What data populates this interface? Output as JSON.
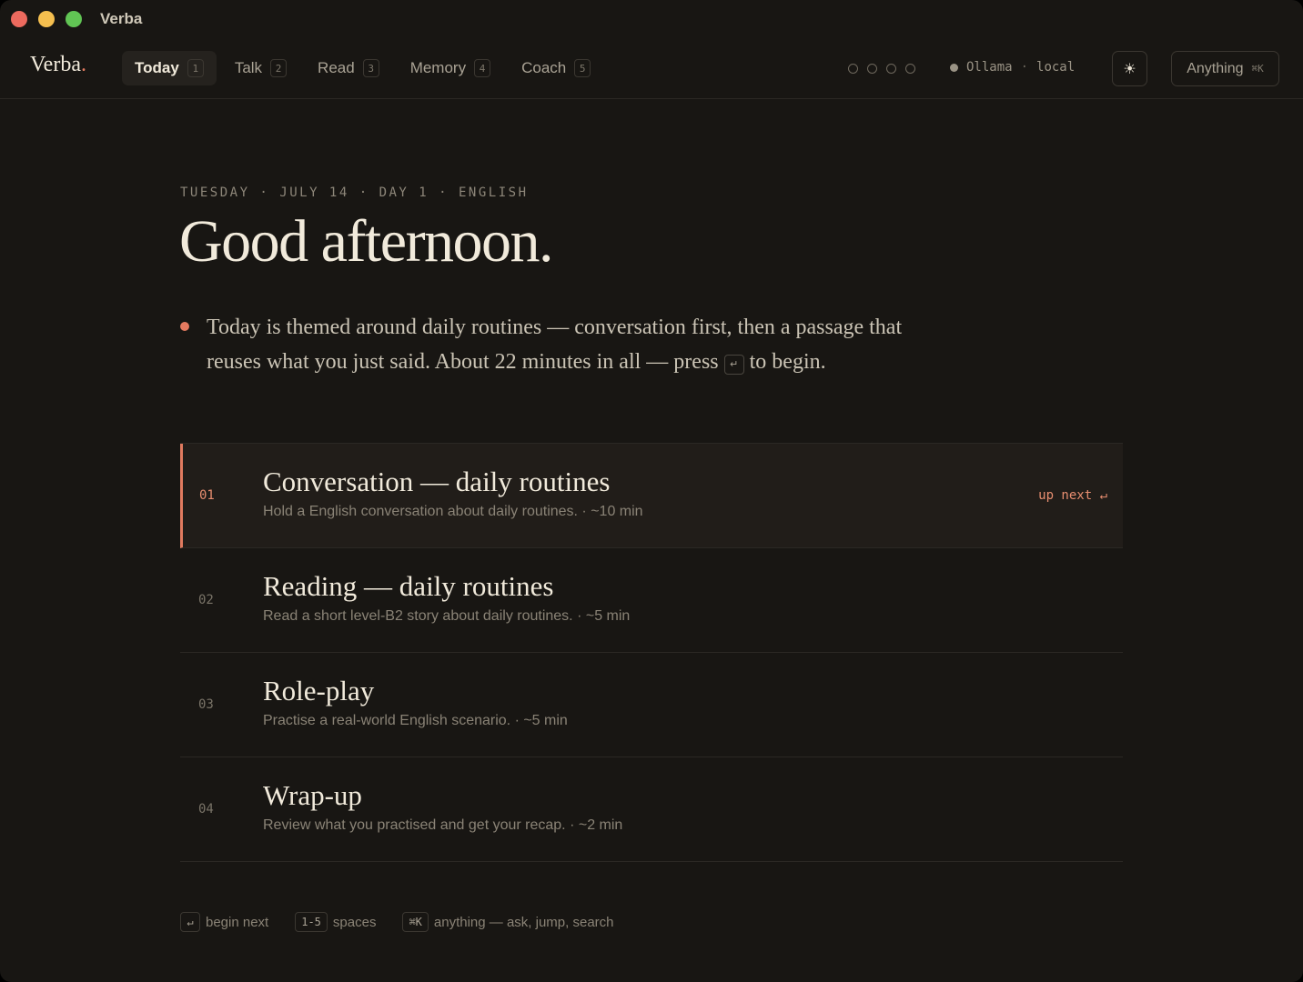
{
  "window": {
    "title": "Verba"
  },
  "nav": {
    "logo": "Verba",
    "logo_dot": ".",
    "tabs": [
      {
        "label": "Today",
        "key": "1"
      },
      {
        "label": "Talk",
        "key": "2"
      },
      {
        "label": "Read",
        "key": "3"
      },
      {
        "label": "Memory",
        "key": "4"
      },
      {
        "label": "Coach",
        "key": "5"
      }
    ],
    "active_tab": "Today",
    "progress_dots": 4,
    "status": {
      "model": "Ollama",
      "sep": "·",
      "mode": "local"
    },
    "theme_icon": "☀",
    "anything": {
      "label": "Anything",
      "shortcut": "⌘K"
    }
  },
  "main": {
    "date_line": "TUESDAY · JULY 14 · DAY 1 · ENGLISH",
    "greeting": "Good afternoon.",
    "intro_before": "Today is themed around daily routines — conversation first, then a passage that reuses what you just said. About 22 minutes in all — press",
    "intro_key": "↵",
    "intro_after": "to begin.",
    "steps": [
      {
        "num": "01",
        "title": "Conversation — daily routines",
        "desc": "Hold a English conversation about daily routines. · ~10 min",
        "badge": "up next ↵"
      },
      {
        "num": "02",
        "title": "Reading — daily routines",
        "desc": "Read a short level-B2 story about daily routines. · ~5 min"
      },
      {
        "num": "03",
        "title": "Role-play",
        "desc": "Practise a real-world English scenario. · ~5 min"
      },
      {
        "num": "04",
        "title": "Wrap-up",
        "desc": "Review what you practised and get your recap. · ~2 min"
      }
    ]
  },
  "footer": {
    "hints": [
      {
        "key": "↵",
        "label": "begin next"
      },
      {
        "key": "1-5",
        "label": "spaces"
      },
      {
        "key": "⌘K",
        "label": "anything — ask, jump, search"
      }
    ]
  },
  "colors": {
    "background": "#181613",
    "accent": "#e07a5f",
    "text": "#f1eadb"
  }
}
